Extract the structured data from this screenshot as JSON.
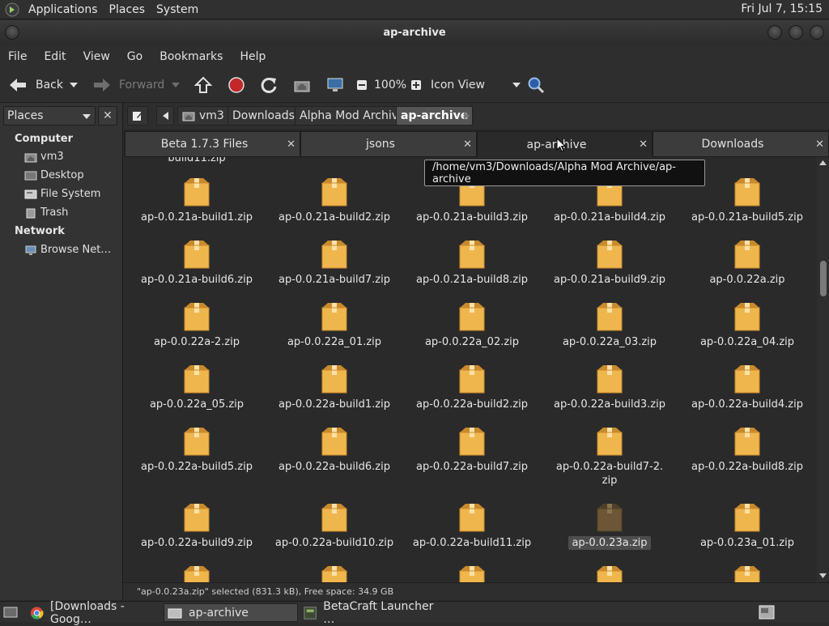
{
  "top_panel": {
    "menus": [
      "Applications",
      "Places",
      "System"
    ],
    "clock": "Fri Jul  7, 15:15"
  },
  "window": {
    "title": "ap-archive"
  },
  "menubar": [
    "File",
    "Edit",
    "View",
    "Go",
    "Bookmarks",
    "Help"
  ],
  "toolbar": {
    "back": "Back",
    "forward": "Forward",
    "zoom": "100%",
    "view_mode": "Icon View"
  },
  "sidebar": {
    "combo": "Places",
    "sections": [
      {
        "title": "Computer",
        "items": [
          "vm3",
          "Desktop",
          "File System",
          "Trash"
        ]
      },
      {
        "title": "Network",
        "items": [
          "Browse Net…"
        ]
      }
    ]
  },
  "pathbar": {
    "crumbs": [
      "vm3",
      "Downloads",
      "Alpha Mod Archive",
      "ap-archive"
    ]
  },
  "tabs": [
    {
      "label": "Beta 1.7.3 Files"
    },
    {
      "label": "jsons"
    },
    {
      "label": "ap-archive"
    },
    {
      "label": "Downloads"
    }
  ],
  "tooltip": "/home/vm3/Downloads/Alpha Mod Archive/ap-archive",
  "partial_top_label": "build11.zip",
  "files": [
    "ap-0.0.21a-build1.zip",
    "ap-0.0.21a-build2.zip",
    "ap-0.0.21a-build3.zip",
    "ap-0.0.21a-build4.zip",
    "ap-0.0.21a-build5.zip",
    "ap-0.0.21a-build6.zip",
    "ap-0.0.21a-build7.zip",
    "ap-0.0.21a-build8.zip",
    "ap-0.0.21a-build9.zip",
    "ap-0.0.22a.zip",
    "ap-0.0.22a-2.zip",
    "ap-0.0.22a_01.zip",
    "ap-0.0.22a_02.zip",
    "ap-0.0.22a_03.zip",
    "ap-0.0.22a_04.zip",
    "ap-0.0.22a_05.zip",
    "ap-0.0.22a-build1.zip",
    "ap-0.0.22a-build2.zip",
    "ap-0.0.22a-build3.zip",
    "ap-0.0.22a-build4.zip",
    "ap-0.0.22a-build5.zip",
    "ap-0.0.22a-build6.zip",
    "ap-0.0.22a-build7.zip",
    "ap-0.0.22a-build7-2.\nzip",
    "ap-0.0.22a-build8.zip",
    "ap-0.0.22a-build9.zip",
    "ap-0.0.22a-build10.zip",
    "ap-0.0.22a-build11.zip",
    "ap-0.0.23a.zip",
    "ap-0.0.23a_01.zip"
  ],
  "selected_file": "ap-0.0.23a.zip",
  "statusbar": "\"ap-0.0.23a.zip\" selected (831.3 kB), Free space: 34.9 GB",
  "taskbar": [
    {
      "label": "[Downloads - Goog…",
      "icon": "chrome-icon"
    },
    {
      "label": "ap-archive",
      "icon": "folder-icon"
    },
    {
      "label": "BetaCraft Launcher …",
      "icon": "betacraft-icon"
    }
  ],
  "colors": {
    "package": "#f0b64e",
    "package_shadow": "#c98a2c",
    "package_selected": "#6b5636"
  }
}
